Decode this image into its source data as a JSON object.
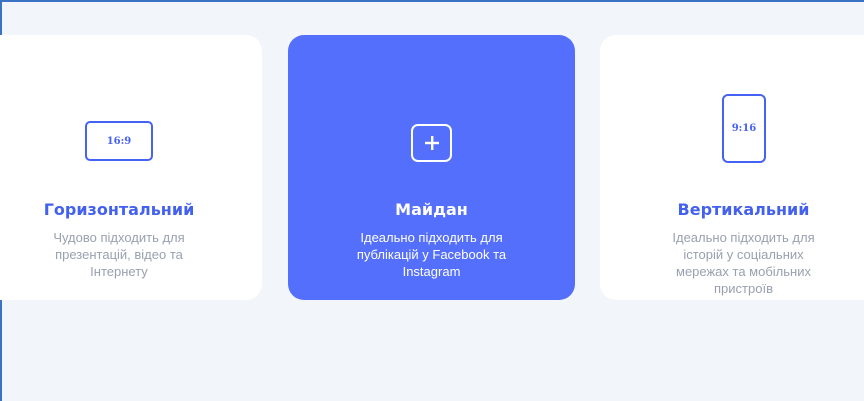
{
  "colors": {
    "accent": "#556ffd",
    "title_blue": "#4361ee",
    "muted_text": "#9aa0b0",
    "background": "#f2f5fa",
    "card_bg": "#ffffff",
    "frame": "#3b73c4"
  },
  "formats": [
    {
      "id": "horizontal",
      "icon": "landscape-16-9-icon",
      "ratio": "16:9",
      "title": "Горизонтальний",
      "description_lines": [
        "Чудово підходить для",
        "презентацій, відео та",
        "Інтернету"
      ],
      "selected": false
    },
    {
      "id": "square",
      "icon": "plus-square-icon",
      "title": "Майдан",
      "description_lines": [
        "Ідеально підходить для",
        "публікацій у Facebook та",
        "Instagram"
      ],
      "selected": true
    },
    {
      "id": "vertical",
      "icon": "portrait-9-16-icon",
      "ratio": "9:16",
      "title": "Вертикальний",
      "description_lines": [
        "Ідеально підходить для",
        "історій у соціальних",
        "мережах та мобільних",
        "пристроїв"
      ],
      "selected": false
    }
  ]
}
